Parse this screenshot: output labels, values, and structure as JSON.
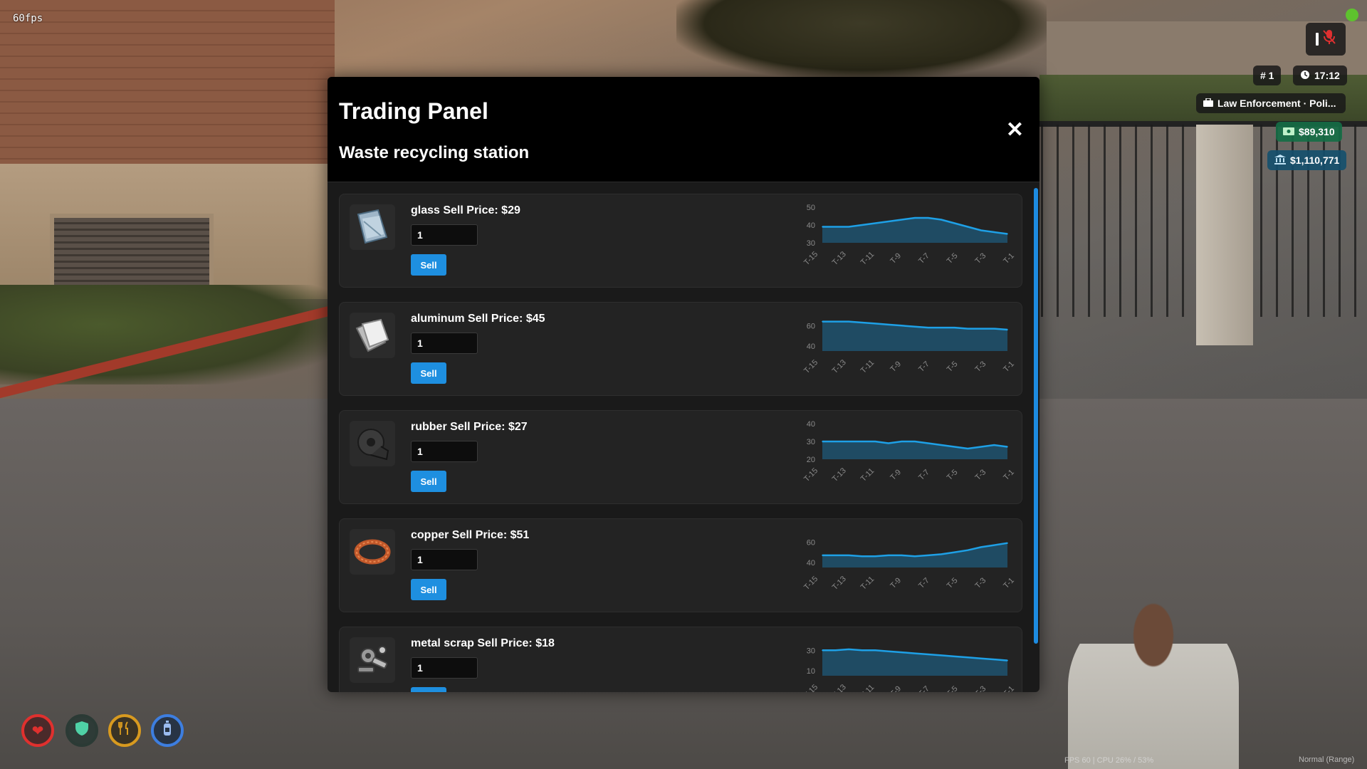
{
  "overlay": {
    "fps": "60fps"
  },
  "hud": {
    "mic_icon": "microphone-muted-icon",
    "player_id": "# 1",
    "time": "17:12",
    "job": "Law Enforcement · Poli...",
    "cash": "$89,310",
    "bank": "$1,110,771",
    "perf_text": "FPS 60  |  CPU 26% / 53%",
    "mode_text": "Normal (Range)"
  },
  "status": {
    "health_icon": "heart-icon",
    "armor_icon": "shield-icon",
    "food_icon": "fork-knife-icon",
    "water_icon": "water-bottle-icon",
    "colors": {
      "health": "#e0302e",
      "armor": "#4fd1a6",
      "food": "#d89a1f",
      "water": "#3d7ee0"
    }
  },
  "panel": {
    "title": "Trading Panel",
    "subtitle": "Waste recycling station",
    "close_label": "✕",
    "sell_label": "Sell",
    "accent": "#1e8fe0",
    "items": [
      {
        "name": "glass Sell Price: $29",
        "icon": "glass-pane-icon",
        "qty": "1"
      },
      {
        "name": "aluminum Sell Price: $45",
        "icon": "aluminum-sheet-icon",
        "qty": "1"
      },
      {
        "name": "rubber Sell Price: $27",
        "icon": "rubber-roll-icon",
        "qty": "1"
      },
      {
        "name": "copper Sell Price: $51",
        "icon": "copper-coil-icon",
        "qty": "1"
      },
      {
        "name": "metal scrap Sell Price: $18",
        "icon": "metal-scrap-icon",
        "qty": "1"
      }
    ]
  },
  "chart_data": [
    {
      "type": "area",
      "series_of": "glass",
      "x": [
        "T-15",
        "T-14",
        "T-13",
        "T-12",
        "T-11",
        "T-10",
        "T-9",
        "T-8",
        "T-7",
        "T-6",
        "T-5",
        "T-4",
        "T-3",
        "T-2",
        "T-1"
      ],
      "values": [
        39,
        39,
        39,
        40,
        41,
        42,
        43,
        44,
        44,
        43,
        41,
        39,
        37,
        36,
        35
      ],
      "yticks": [
        30,
        40,
        50
      ],
      "ylim": [
        30,
        50
      ],
      "tick_labels": [
        "T-15",
        "T-13",
        "T-11",
        "T-9",
        "T-7",
        "T-5",
        "T-3",
        "T-1"
      ]
    },
    {
      "type": "area",
      "series_of": "aluminum",
      "x": [
        "T-15",
        "T-14",
        "T-13",
        "T-12",
        "T-11",
        "T-10",
        "T-9",
        "T-8",
        "T-7",
        "T-6",
        "T-5",
        "T-4",
        "T-3",
        "T-2",
        "T-1"
      ],
      "values": [
        64,
        64,
        64,
        63,
        62,
        61,
        60,
        59,
        58,
        58,
        58,
        57,
        57,
        57,
        56
      ],
      "yticks": [
        40,
        60
      ],
      "ylim": [
        35,
        70
      ],
      "tick_labels": [
        "T-15",
        "T-13",
        "T-11",
        "T-9",
        "T-7",
        "T-5",
        "T-3",
        "T-1"
      ]
    },
    {
      "type": "area",
      "series_of": "rubber",
      "x": [
        "T-15",
        "T-14",
        "T-13",
        "T-12",
        "T-11",
        "T-10",
        "T-9",
        "T-8",
        "T-7",
        "T-6",
        "T-5",
        "T-4",
        "T-3",
        "T-2",
        "T-1"
      ],
      "values": [
        30,
        30,
        30,
        30,
        30,
        29,
        30,
        30,
        29,
        28,
        27,
        26,
        27,
        28,
        27
      ],
      "yticks": [
        20,
        30,
        40
      ],
      "ylim": [
        20,
        40
      ],
      "tick_labels": [
        "T-15",
        "T-13",
        "T-11",
        "T-9",
        "T-7",
        "T-5",
        "T-3",
        "T-1"
      ]
    },
    {
      "type": "area",
      "series_of": "copper",
      "x": [
        "T-15",
        "T-14",
        "T-13",
        "T-12",
        "T-11",
        "T-10",
        "T-9",
        "T-8",
        "T-7",
        "T-6",
        "T-5",
        "T-4",
        "T-3",
        "T-2",
        "T-1"
      ],
      "values": [
        47,
        47,
        47,
        46,
        46,
        47,
        47,
        46,
        47,
        48,
        50,
        52,
        55,
        57,
        59
      ],
      "yticks": [
        40,
        60
      ],
      "ylim": [
        35,
        70
      ],
      "tick_labels": [
        "T-15",
        "T-13",
        "T-11",
        "T-9",
        "T-7",
        "T-5",
        "T-3",
        "T-1"
      ]
    },
    {
      "type": "area",
      "series_of": "metal scrap",
      "x": [
        "T-15",
        "T-14",
        "T-13",
        "T-12",
        "T-11",
        "T-10",
        "T-9",
        "T-8",
        "T-7",
        "T-6",
        "T-5",
        "T-4",
        "T-3",
        "T-2",
        "T-1"
      ],
      "values": [
        30,
        30,
        31,
        30,
        30,
        29,
        28,
        27,
        26,
        25,
        24,
        23,
        22,
        21,
        20
      ],
      "yticks": [
        10,
        30
      ],
      "ylim": [
        5,
        40
      ],
      "tick_labels": [
        "T-15",
        "T-13",
        "T-11",
        "T-9",
        "T-7",
        "T-5",
        "T-3",
        "T-1"
      ]
    }
  ]
}
